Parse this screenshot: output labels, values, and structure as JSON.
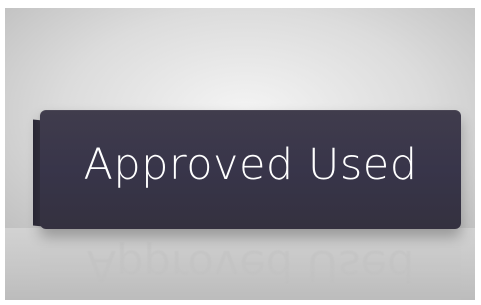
{
  "sign": {
    "text": "Approved Used",
    "panel_color": "#3a3746",
    "text_color": "#ffffff"
  },
  "scene": {
    "background_color": "#e0e0e0"
  }
}
